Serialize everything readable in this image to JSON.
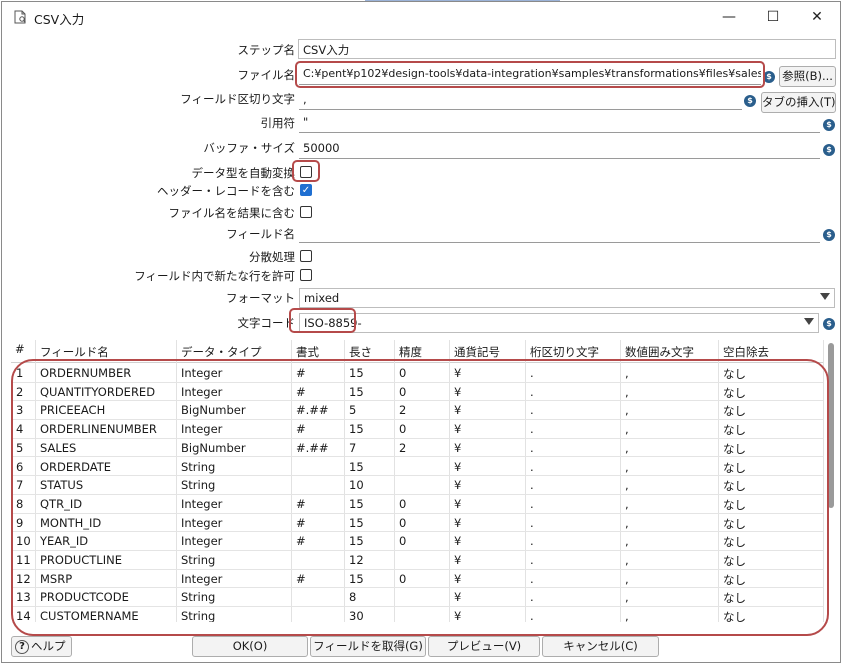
{
  "window": {
    "title": "CSV入力",
    "minimize": "—",
    "maximize": "☐",
    "close": "✕"
  },
  "form": {
    "step_name_label": "ステップ名",
    "step_name_value": "CSV入力",
    "file_name_label": "ファイル名",
    "file_name_value": "C:¥pent¥p102¥design-tools¥data-integration¥samples¥transformations¥files¥sales_data.c",
    "browse_button": "参照(B)...",
    "delimiter_label": "フィールド区切り文字",
    "delimiter_value": ",",
    "insert_tab_button": "タブの挿入(T)",
    "enclosure_label": "引用符",
    "enclosure_value": "\"",
    "buffer_label": "バッファ・サイズ",
    "buffer_value": "50000",
    "lazy_conversion_label": "データ型を自動変換",
    "lazy_conversion_checked": false,
    "header_label": "ヘッダー・レコードを含む",
    "header_checked": true,
    "add_filename_label": "ファイル名を結果に含む",
    "add_filename_checked": false,
    "field_name_label": "フィールド名",
    "field_name_value": "",
    "parallel_label": "分散処理",
    "parallel_checked": false,
    "newline_label": "フィールド内で新たな行を許可",
    "newline_checked": false,
    "format_label": "フォーマット",
    "format_value": "mixed",
    "encoding_label": "文字コード",
    "encoding_value": "ISO-8859-"
  },
  "grid": {
    "headers": [
      "#",
      "フィールド名",
      "データ・タイプ",
      "書式",
      "長さ",
      "精度",
      "通貨記号",
      "桁区切り文字",
      "数値囲み文字",
      "空白除去"
    ],
    "rows": [
      [
        "1",
        "ORDERNUMBER",
        "Integer",
        "#",
        "15",
        "0",
        "¥",
        ".",
        ",",
        "なし"
      ],
      [
        "2",
        "QUANTITYORDERED",
        "Integer",
        "#",
        "15",
        "0",
        "¥",
        ".",
        ",",
        "なし"
      ],
      [
        "3",
        "PRICEEACH",
        "BigNumber",
        "#.##",
        "5",
        "2",
        "¥",
        ".",
        ",",
        "なし"
      ],
      [
        "4",
        "ORDERLINENUMBER",
        "Integer",
        "#",
        "15",
        "0",
        "¥",
        ".",
        ",",
        "なし"
      ],
      [
        "5",
        "SALES",
        "BigNumber",
        "#.##",
        "7",
        "2",
        "¥",
        ".",
        ",",
        "なし"
      ],
      [
        "6",
        "ORDERDATE",
        "String",
        "",
        "15",
        "",
        "¥",
        ".",
        ",",
        "なし"
      ],
      [
        "7",
        "STATUS",
        "String",
        "",
        "10",
        "",
        "¥",
        ".",
        ",",
        "なし"
      ],
      [
        "8",
        "QTR_ID",
        "Integer",
        "#",
        "15",
        "0",
        "¥",
        ".",
        ",",
        "なし"
      ],
      [
        "9",
        "MONTH_ID",
        "Integer",
        "#",
        "15",
        "0",
        "¥",
        ".",
        ",",
        "なし"
      ],
      [
        "10",
        "YEAR_ID",
        "Integer",
        "#",
        "15",
        "0",
        "¥",
        ".",
        ",",
        "なし"
      ],
      [
        "11",
        "PRODUCTLINE",
        "String",
        "",
        "12",
        "",
        "¥",
        ".",
        ",",
        "なし"
      ],
      [
        "12",
        "MSRP",
        "Integer",
        "#",
        "15",
        "0",
        "¥",
        ".",
        ",",
        "なし"
      ],
      [
        "13",
        "PRODUCTCODE",
        "String",
        "",
        "8",
        "",
        "¥",
        ".",
        ",",
        "なし"
      ],
      [
        "14",
        "CUSTOMERNAME",
        "String",
        "",
        "30",
        "",
        "¥",
        ".",
        ",",
        "なし"
      ]
    ]
  },
  "buttons": {
    "help": "ヘルプ",
    "ok": "OK(O)",
    "get_fields": "フィールドを取得(G)",
    "preview": "プレビュー(V)",
    "cancel": "キャンセル(C)"
  },
  "colors": {
    "highlight": "#b54a4a",
    "checkbox_checked": "#1f6fd1",
    "variable_icon": "#2a5e8c"
  }
}
